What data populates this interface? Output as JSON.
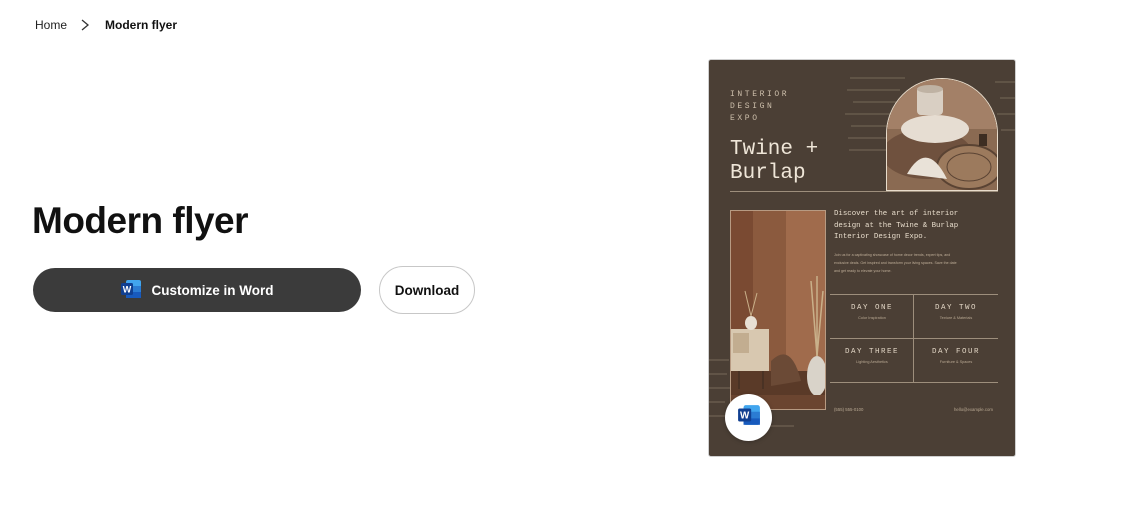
{
  "breadcrumb": {
    "home": "Home",
    "current": "Modern flyer"
  },
  "page": {
    "title": "Modern flyer"
  },
  "actions": {
    "customize_label": "Customize in Word",
    "download_label": "Download"
  },
  "flyer": {
    "eyebrow": [
      "INTERIOR",
      "DESIGN",
      "EXPO"
    ],
    "title_lines": [
      "Twine +",
      "Burlap"
    ],
    "intro_lines": [
      "Discover the art of interior",
      "design at the Twine & Burlap",
      "Interior Design Expo."
    ],
    "body_lines": [
      "Join us for a captivating showcase of home decor trends, expert tips, and",
      "exclusive deals. Get inspired and transform your living spaces. Save the date",
      "and get ready to elevate your home."
    ],
    "days": [
      {
        "day": "DAY ONE",
        "topic": "Color Inspiration"
      },
      {
        "day": "DAY TWO",
        "topic": "Texture & Materials"
      },
      {
        "day": "DAY THREE",
        "topic": "Lighting Aesthetics"
      },
      {
        "day": "DAY FOUR",
        "topic": "Furniture & Spaces"
      }
    ],
    "phone": "(555) 555-0100",
    "email": "hello@example.com",
    "colors": {
      "background": "#4b3f35",
      "text": "#e4d9c9"
    }
  },
  "icons": {
    "chevron": "chevron-right-icon",
    "word": "word-app-icon"
  },
  "colors": {
    "primary_button": "#3b3b3b",
    "word_blue": "#185abd"
  }
}
